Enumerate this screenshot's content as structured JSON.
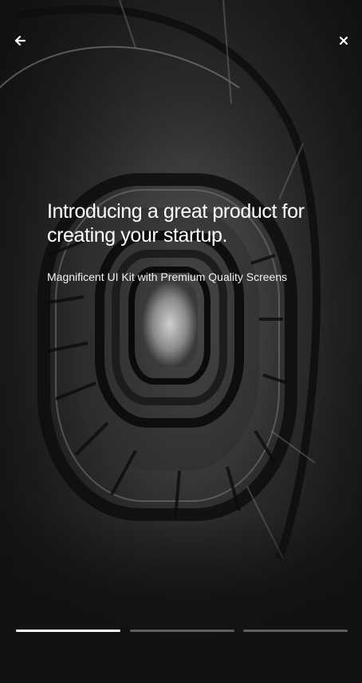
{
  "header": {
    "back_icon": "arrow-left-icon",
    "close_icon": "close-icon"
  },
  "slide": {
    "headline": "Introducing a great product for creating your startup.",
    "subline": "Magnificent UI Kit with Premium Quality Screens"
  },
  "progress": {
    "segments": [
      {
        "name": "story-1",
        "fill": 1.0
      },
      {
        "name": "story-2",
        "fill": 0.0
      },
      {
        "name": "story-3",
        "fill": 0.0
      }
    ],
    "active_color": "#ffffff",
    "inactive_color": "#5e5e5e"
  },
  "colors": {
    "background": "#121212",
    "text": "#ffffff"
  }
}
